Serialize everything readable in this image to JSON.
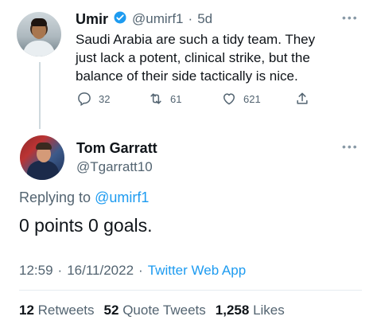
{
  "parent_tweet": {
    "author_name": "Umir",
    "handle": "@umirf1",
    "separator": "·",
    "age": "5d",
    "text_lines": [
      "Saudi Arabia are such a tidy team. They",
      "just lack a potent, clinical strike, but the",
      "balance of their side tactically is nice."
    ],
    "reply_count": "32",
    "retweet_count": "61",
    "like_count": "621",
    "icons": [
      "verified-badge-icon",
      "more-icon",
      "reply-icon",
      "retweet-icon",
      "like-icon",
      "share-icon"
    ]
  },
  "main_tweet": {
    "author_name": "Tom Garratt",
    "handle": "@Tgarratt10",
    "replying_to_prefix": "Replying to",
    "replying_to_handle": "@umirf1",
    "text": "0 points 0 goals.",
    "time": "12:59",
    "date_sep": "·",
    "date": "16/11/2022",
    "source_sep": "·",
    "source": "Twitter Web App",
    "retweets_count": "12",
    "retweets_label": "Retweets",
    "quotes_count": "52",
    "quotes_label": "Quote Tweets",
    "likes_count": "1,258",
    "likes_label": "Likes"
  },
  "colors": {
    "accent": "#1d9bf0",
    "muted": "#536471",
    "text": "#0f1419",
    "divider": "#e6ecf0"
  }
}
